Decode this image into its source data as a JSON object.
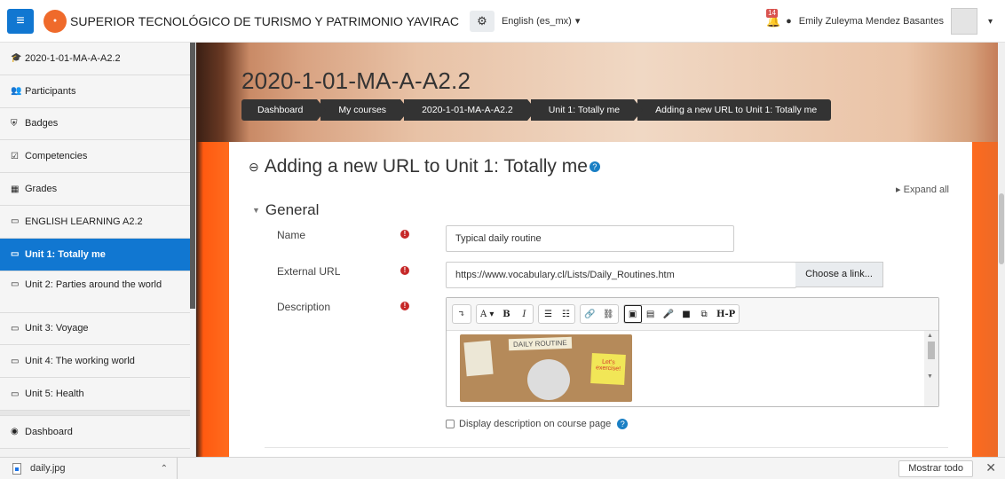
{
  "navbar": {
    "menu_icon": "hamburger-icon",
    "site_name": "SUPERIOR TECNOLÓGICO DE TURISMO Y PATRIMONIO YAVIRAC",
    "settings_icon": "cogs-icon",
    "language": "English (es_mx)",
    "notification_count": "14",
    "user_name": "Emily Zuleyma Mendez Basantes"
  },
  "drawer": {
    "items": [
      {
        "icon": "graduation-cap-icon",
        "label": "2020-1-01-MA-A-A2.2"
      },
      {
        "icon": "users-icon",
        "label": "Participants"
      },
      {
        "icon": "shield-icon",
        "label": "Badges"
      },
      {
        "icon": "checkbox-icon",
        "label": "Competencies"
      },
      {
        "icon": "table-icon",
        "label": "Grades"
      },
      {
        "icon": "folder-icon",
        "label": "ENGLISH LEARNING A2.2"
      },
      {
        "icon": "folder-icon",
        "label": "Unit 1: Totally me"
      },
      {
        "icon": "folder-icon",
        "label": "Unit 2: Parties around the world"
      },
      {
        "icon": "folder-icon",
        "label": "Unit 3: Voyage"
      },
      {
        "icon": "folder-icon",
        "label": "Unit 4: The working world"
      },
      {
        "icon": "folder-icon",
        "label": "Unit 5: Health"
      },
      {
        "icon": "dashboard-icon",
        "label": "Dashboard"
      }
    ],
    "active_index": 6
  },
  "header": {
    "course_title": "2020-1-01-MA-A-A2.2",
    "breadcrumbs": [
      "Dashboard",
      "My courses",
      "2020-1-01-MA-A-A2.2",
      "Unit 1: Totally me",
      "Adding a new URL to Unit 1: Totally me"
    ]
  },
  "main": {
    "heading": "Adding a new URL to Unit 1: Totally me",
    "expand_all": "Expand all",
    "section_title": "General",
    "name_label": "Name",
    "name_value": "Typical daily routine",
    "url_label": "External URL",
    "url_value": "https://www.vocabulary.cl/Lists/Daily_Routines.htm",
    "choose_link": "Choose a link...",
    "description_label": "Description",
    "image_title": "DAILY ROUTINE",
    "image_note": "Let's exercise!",
    "checkbox_label": "Display description on course page"
  },
  "editor_toolbar": {
    "buttons": [
      "↴",
      "A ▾",
      "B",
      "I",
      "☰",
      "☷",
      "🔗",
      "⛓",
      "▣",
      "▤",
      "🎤",
      "■",
      "⧉",
      "H-P"
    ]
  },
  "download_bar": {
    "file_name": "daily.jpg",
    "show_all": "Mostrar todo"
  },
  "colors": {
    "primary": "#1177d1",
    "accent": "#ff6a1d",
    "dark": "#333333"
  }
}
